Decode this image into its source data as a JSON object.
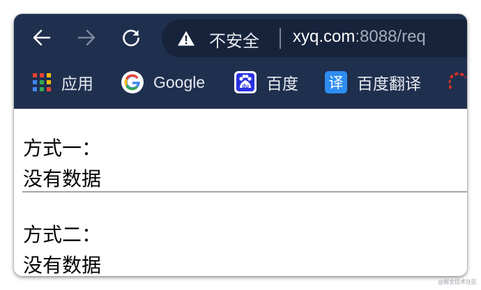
{
  "browser": {
    "nav": {
      "back_icon": "arrow-left-icon",
      "forward_icon": "arrow-right-icon",
      "reload_icon": "reload-icon"
    },
    "omnibox": {
      "security_icon": "warning-triangle-icon",
      "security_label": "不安全",
      "url_host": "xyq.com",
      "url_rest": ":8088/req"
    },
    "bookmarks": [
      {
        "label": "应用",
        "icon": "apps-grid-icon"
      },
      {
        "label": "Google",
        "icon": "google-icon"
      },
      {
        "label": "百度",
        "icon": "baidu-icon"
      },
      {
        "label": "百度翻译",
        "icon": "baidu-translate-icon"
      }
    ],
    "colors": {
      "chrome_bg": "#1f2f4e",
      "omnibox_bg": "#17233b"
    }
  },
  "page": {
    "section1": {
      "title": "方式一：",
      "text": "没有数据"
    },
    "section2": {
      "title": "方式二：",
      "text": "没有数据"
    }
  },
  "watermark": "@掘金技术社区"
}
